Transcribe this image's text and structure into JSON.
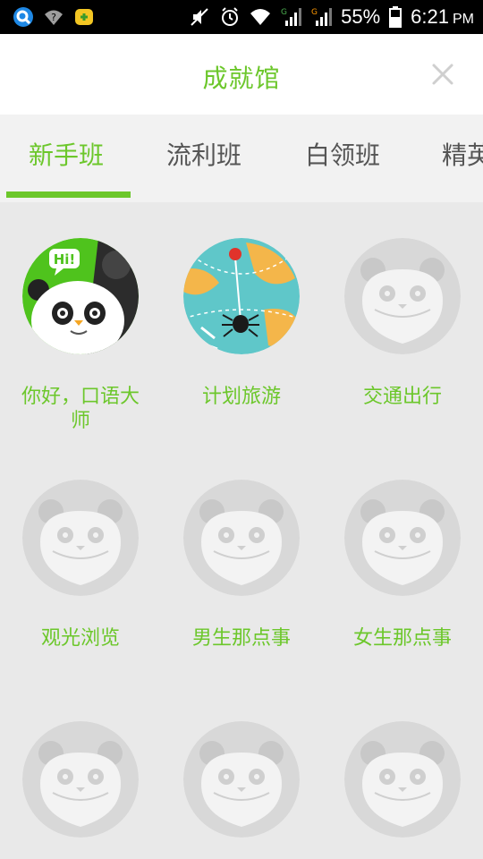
{
  "status_bar": {
    "battery": "55%",
    "time": "6:21",
    "ampm": "PM"
  },
  "header": {
    "title": "成就馆"
  },
  "tabs": [
    {
      "label": "新手班",
      "active": true
    },
    {
      "label": "流利班",
      "active": false
    },
    {
      "label": "白领班",
      "active": false
    },
    {
      "label": "精英",
      "active": false
    }
  ],
  "achievements": [
    {
      "label": "你好，口语大师",
      "unlocked": true,
      "icon": "panda-hi-badge-icon"
    },
    {
      "label": "计划旅游",
      "unlocked": true,
      "icon": "globe-spider-badge-icon"
    },
    {
      "label": "交通出行",
      "unlocked": false,
      "icon": "locked-panda-icon"
    },
    {
      "label": "观光浏览",
      "unlocked": false,
      "icon": "locked-panda-icon"
    },
    {
      "label": "男生那点事",
      "unlocked": false,
      "icon": "locked-panda-icon"
    },
    {
      "label": "女生那点事",
      "unlocked": false,
      "icon": "locked-panda-icon"
    },
    {
      "label": "",
      "unlocked": false,
      "icon": "locked-panda-icon"
    },
    {
      "label": "",
      "unlocked": false,
      "icon": "locked-panda-icon"
    },
    {
      "label": "",
      "unlocked": false,
      "icon": "locked-panda-icon"
    }
  ],
  "badges_hi_text": "Hi!",
  "colors": {
    "accent": "#6cc72b",
    "background": "#e9e9e9",
    "locked": "#d8d8d8"
  }
}
